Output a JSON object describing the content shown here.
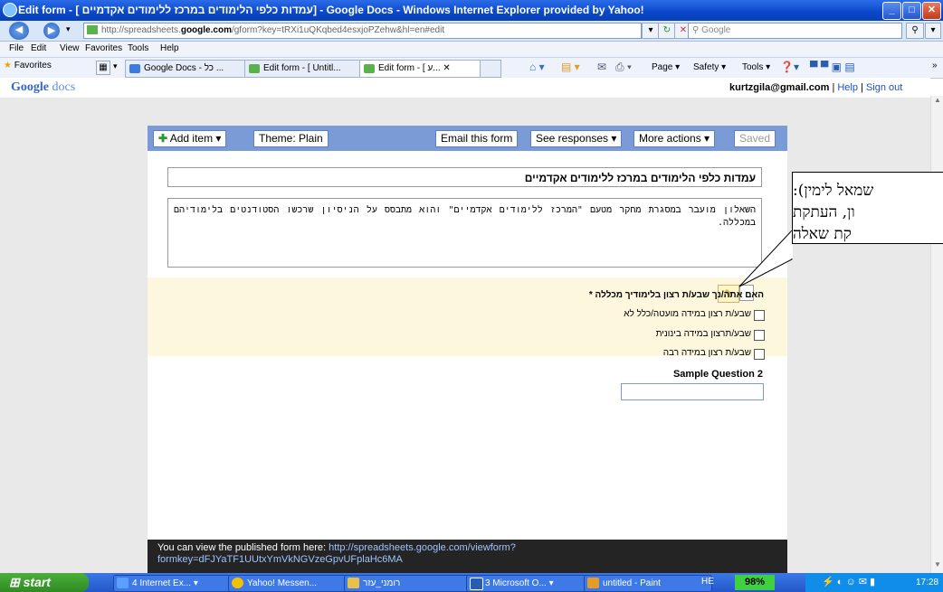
{
  "window": {
    "title": "Edit form - [ עמדות כלפי הלימודים במרכז ללימודים אקדמיים] - Google Docs - Windows Internet Explorer provided by Yahoo!",
    "controls": [
      "_",
      "□",
      "✕"
    ]
  },
  "address_bar": {
    "url_prefix": "http://spreadsheets.",
    "url_host": "google.com",
    "url_suffix": "/gform?key=tRXi1uQKqbed4esxjoPZehw&hl=en#edit",
    "search_placeholder": "Google"
  },
  "menu": [
    "File",
    "Edit",
    "View",
    "Favorites",
    "Tools",
    "Help"
  ],
  "favorites_label": "Favorites",
  "tabs": [
    {
      "label": "Google Docs - כל ..."
    },
    {
      "label": "Edit form - [ Untitl..."
    },
    {
      "label": "Edit form - [ ע... ✕"
    }
  ],
  "command_bar": {
    "page": "Page ▾",
    "safety": "Safety ▾",
    "tools": "Tools ▾"
  },
  "gdocs": {
    "logo_google": "Google",
    "logo_docs": "docs",
    "user_email": "kurtzgila@gmail.com",
    "help": "Help",
    "signout": "Sign out",
    "sep": "|"
  },
  "toolbar": {
    "add_item": "Add item ▾",
    "theme": "Theme: Plain",
    "email_form": "Email this form",
    "see_responses": "See responses ▾",
    "more_actions": "More actions ▾",
    "saved": "Saved"
  },
  "form": {
    "title": "עמדות כלפי הלימודים במרכז ללימודים אקדמיים",
    "description": "השאלון מועבר במסגרת מחקר מטעם \"המרכז ללימודים אקדמיים\" והוא מתבסס על הניסיון שרכשו הסטודנטים בלימודיהם במכללה.",
    "question1": {
      "label": "האם אתה/נך שבע/ת רצון בלימודיך מכללה *",
      "options": [
        "שבע/ת רצון במידה מועטה/כלל לא",
        "שבע/תרצון במידה בינונית",
        "שבע/ת רצון במידה רבה"
      ]
    },
    "question2": {
      "label": "Sample Question 2",
      "value": ""
    }
  },
  "footer": {
    "line1": "You can view the published form here: ",
    "link": "http://spreadsheets.google.com/viewform?formkey=dFJYaTF1UUtxYmVkNGVzeGpvUFplaHc6MA"
  },
  "callout": {
    "line1": "שמאל לימין):",
    "line2": "ון, העתקת",
    "line3": "קת שאלה"
  },
  "taskbar": {
    "start": "start",
    "items": [
      {
        "label": "4 Internet Ex... ▾",
        "color": "#2b6ce8"
      },
      {
        "label": "Yahoo! Messen...",
        "color": "#f2c200"
      },
      {
        "label": "רומני_עזר",
        "color": "#e8c14a"
      },
      {
        "label": "3 Microsoft O... ▾",
        "color": "#2a5db0"
      },
      {
        "label": "untitled - Paint",
        "color": "#e59a2a"
      }
    ],
    "lang": "HE",
    "battery": "98%",
    "clock": "17:28"
  }
}
